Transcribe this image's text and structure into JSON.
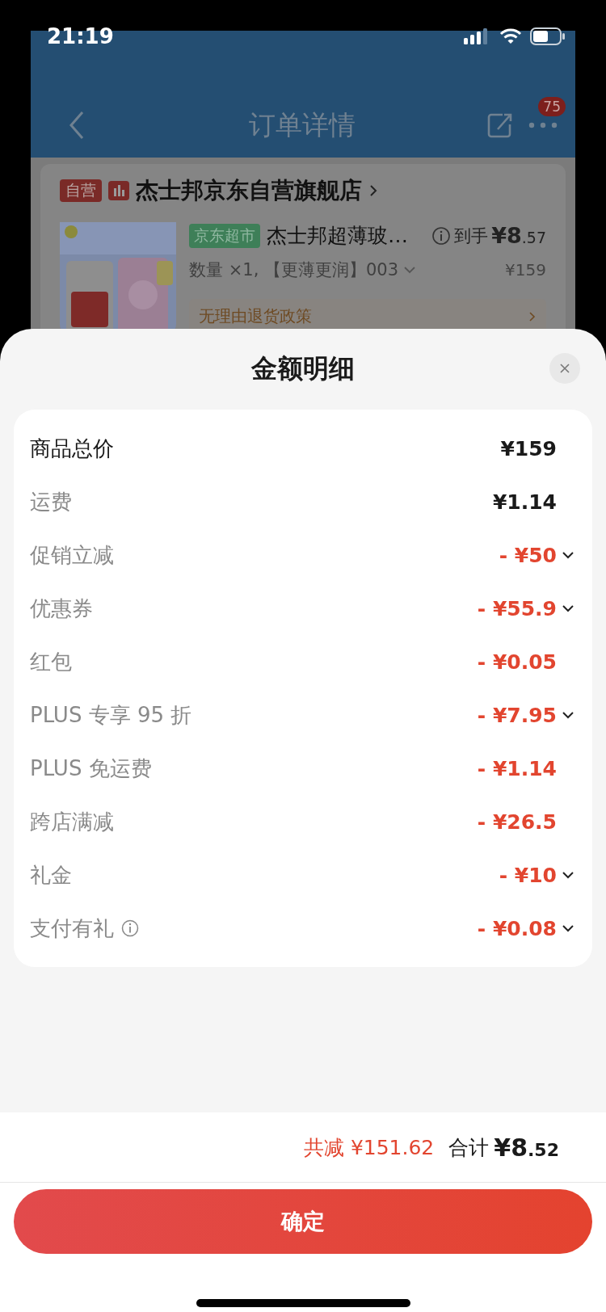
{
  "status_bar": {
    "time": "21:19"
  },
  "background_page": {
    "nav": {
      "title": "订单详情",
      "badge": "75"
    },
    "store": {
      "tag": "自营",
      "name": "杰士邦京东自营旗舰店"
    },
    "product": {
      "tag": "京东超市",
      "title": "杰士邦超薄玻…",
      "price_label": "到手",
      "price": "¥8.57",
      "spec": "数量 ×1, 【更薄更润】003",
      "original_price": "¥159",
      "policy": "无理由退货政策"
    }
  },
  "sheet": {
    "title": "金额明细",
    "rows": [
      {
        "kind": "total",
        "label": "商品总价",
        "value": "¥159",
        "expandable": false,
        "info": false
      },
      {
        "kind": "fee",
        "label": "运费",
        "value": "¥1.14",
        "expandable": false,
        "info": false
      },
      {
        "kind": "discount",
        "label": "促销立减",
        "value": "- ¥50",
        "expandable": true,
        "info": false
      },
      {
        "kind": "discount",
        "label": "优惠券",
        "value": "- ¥55.9",
        "expandable": true,
        "info": false
      },
      {
        "kind": "discount",
        "label": "红包",
        "value": "- ¥0.05",
        "expandable": false,
        "info": false
      },
      {
        "kind": "discount",
        "label": "PLUS 专享 95 折",
        "value": "- ¥7.95",
        "expandable": true,
        "info": false
      },
      {
        "kind": "discount",
        "label": "PLUS 免运费",
        "value": "- ¥1.14",
        "expandable": false,
        "info": false
      },
      {
        "kind": "discount",
        "label": "跨店满减",
        "value": "- ¥26.5",
        "expandable": false,
        "info": false
      },
      {
        "kind": "discount",
        "label": "礼金",
        "value": "- ¥10",
        "expandable": true,
        "info": false
      },
      {
        "kind": "discount",
        "label": "支付有礼",
        "value": "- ¥0.08",
        "expandable": true,
        "info": true
      }
    ],
    "saved": "共减 ¥151.62",
    "total_label": "合计",
    "total": "¥8.52",
    "confirm": "确定"
  }
}
